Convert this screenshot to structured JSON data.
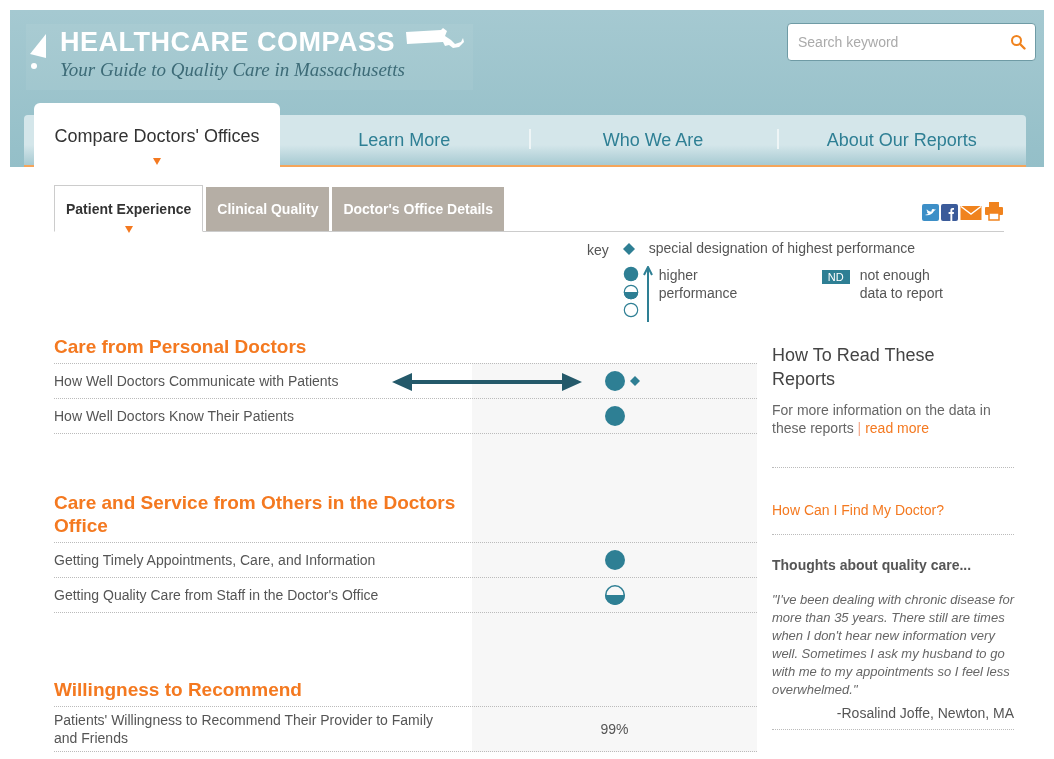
{
  "header": {
    "title": "HEALTHCARE COMPASS",
    "tagline": "Your Guide to Quality Care in Massachusetts",
    "search": {
      "placeholder": "Search keyword"
    }
  },
  "nav": [
    {
      "label": "Compare Doctors' Offices",
      "selected": true
    },
    {
      "label": "Learn More",
      "selected": false
    },
    {
      "label": "Who We Are",
      "selected": false
    },
    {
      "label": "About Our Reports",
      "selected": false
    }
  ],
  "subtabs": [
    {
      "label": "Patient Experience",
      "selected": true
    },
    {
      "label": "Clinical Quality",
      "selected": false
    },
    {
      "label": "Doctor's Office Details",
      "selected": false
    }
  ],
  "share": [
    {
      "kind": "twitter"
    },
    {
      "kind": "facebook"
    },
    {
      "kind": "email"
    },
    {
      "kind": "print"
    }
  ],
  "key": {
    "label": "key",
    "designation": "special designation of highest performance",
    "performance": "higher performance",
    "nd_badge": "ND",
    "nd_text": "not enough data to report"
  },
  "sections": [
    {
      "title": "Care from Personal Doctors",
      "rows": [
        {
          "label": "How Well Doctors Communicate with Patients",
          "kind": "full",
          "designation": true,
          "arrow": true
        },
        {
          "label": "How Well Doctors Know Their Patients",
          "kind": "full",
          "designation": false,
          "arrow": false
        }
      ]
    },
    {
      "title": "Care and Service from Others in the Doctors Office",
      "rows": [
        {
          "label": "Getting Timely Appointments, Care, and Information",
          "kind": "full",
          "designation": false,
          "arrow": false
        },
        {
          "label": "Getting Quality Care from Staff in the Doctor's Office",
          "kind": "half",
          "designation": false,
          "arrow": false
        }
      ]
    },
    {
      "title": "Willingness to Recommend",
      "rows": [
        {
          "label": "Patients' Willingness to Recommend Their Provider to Family and Friends",
          "kind": "percent",
          "value": "99%",
          "designation": false,
          "arrow": false
        }
      ]
    }
  ],
  "sidebar": {
    "how_to": {
      "title": "How To Read These Reports",
      "text": "For more information on the data in these reports",
      "separator": "|",
      "link": "read more"
    },
    "find_link": "How Can I Find My Doctor?",
    "quote": {
      "heading": "Thoughts about quality care...",
      "text": "\"I've been dealing with chronic disease for more than 35 years. There still are times when I don't hear new information very well. Sometimes I ask my husband to go with me to my appointments so I feel less overwhelmed.\"",
      "attribution": "-Rosalind Joffe, Newton, MA"
    }
  }
}
